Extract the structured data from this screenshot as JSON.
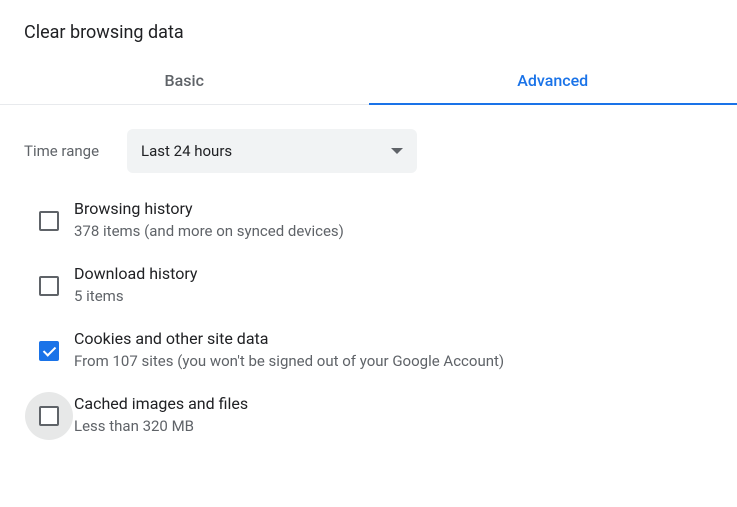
{
  "title": "Clear browsing data",
  "tabs": {
    "basic": "Basic",
    "advanced": "Advanced"
  },
  "timeRange": {
    "label": "Time range",
    "selected": "Last 24 hours"
  },
  "options": [
    {
      "title": "Browsing history",
      "subtitle": "378 items (and more on synced devices)",
      "checked": false,
      "ripple": false
    },
    {
      "title": "Download history",
      "subtitle": "5 items",
      "checked": false,
      "ripple": false
    },
    {
      "title": "Cookies and other site data",
      "subtitle": "From 107 sites (you won't be signed out of your Google Account)",
      "checked": true,
      "ripple": false
    },
    {
      "title": "Cached images and files",
      "subtitle": "Less than 320 MB",
      "checked": false,
      "ripple": true
    }
  ]
}
